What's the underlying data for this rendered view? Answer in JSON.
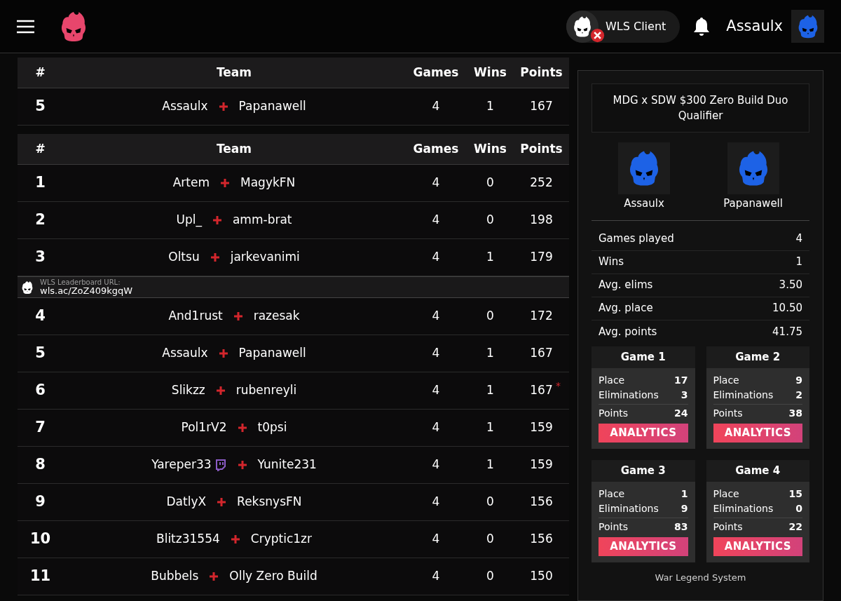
{
  "header": {
    "client": {
      "label": "WLS Client",
      "connected": false
    },
    "username": "Assaulx"
  },
  "my_team": {
    "columns": [
      "#",
      "Team",
      "Games",
      "Wins",
      "Points"
    ],
    "rows": [
      {
        "kind": "team",
        "rank": "5",
        "players": [
          {
            "name": "Assaulx",
            "streaming": false
          },
          {
            "name": "Papanawell",
            "streaming": false
          }
        ],
        "games": "4",
        "wins": "1",
        "points": "167"
      }
    ]
  },
  "leaderboard": {
    "columns": [
      "#",
      "Team",
      "Games",
      "Wins",
      "Points"
    ],
    "rows": [
      {
        "kind": "team",
        "rank": "1",
        "players": [
          {
            "name": "Artem",
            "streaming": false
          },
          {
            "name": "MagykFN",
            "streaming": false
          }
        ],
        "games": "4",
        "wins": "0",
        "points": "252"
      },
      {
        "kind": "team",
        "rank": "2",
        "players": [
          {
            "name": "Upl_",
            "streaming": false
          },
          {
            "name": "amm-brat",
            "streaming": false
          }
        ],
        "games": "4",
        "wins": "0",
        "points": "198"
      },
      {
        "kind": "team",
        "rank": "3",
        "players": [
          {
            "name": "Oltsu",
            "streaming": false
          },
          {
            "name": "jarkevanimi",
            "streaming": false
          }
        ],
        "games": "4",
        "wins": "1",
        "points": "179"
      },
      {
        "kind": "banner",
        "label": "WLS Leaderboard URL:",
        "url": "wls.ac/ZoZ409kgqW"
      },
      {
        "kind": "team",
        "rank": "4",
        "players": [
          {
            "name": "And1rust",
            "streaming": false
          },
          {
            "name": "razesak",
            "streaming": false
          }
        ],
        "games": "4",
        "wins": "0",
        "points": "172"
      },
      {
        "kind": "team",
        "rank": "5",
        "players": [
          {
            "name": "Assaulx",
            "streaming": false
          },
          {
            "name": "Papanawell",
            "streaming": false
          }
        ],
        "games": "4",
        "wins": "1",
        "points": "167"
      },
      {
        "kind": "team",
        "rank": "6",
        "players": [
          {
            "name": "Slikzz",
            "streaming": false
          },
          {
            "name": "rubenreyli",
            "streaming": false
          }
        ],
        "games": "4",
        "wins": "1",
        "points": "167",
        "points_note": "*"
      },
      {
        "kind": "team",
        "rank": "7",
        "players": [
          {
            "name": "Pol1rV2",
            "streaming": false
          },
          {
            "name": "t0psi",
            "streaming": false
          }
        ],
        "games": "4",
        "wins": "1",
        "points": "159"
      },
      {
        "kind": "team",
        "rank": "8",
        "players": [
          {
            "name": "Yareper33",
            "streaming": true
          },
          {
            "name": "Yunite231",
            "streaming": false
          }
        ],
        "games": "4",
        "wins": "1",
        "points": "159"
      },
      {
        "kind": "team",
        "rank": "9",
        "players": [
          {
            "name": "DatlyX",
            "streaming": false
          },
          {
            "name": "ReksnysFN",
            "streaming": false
          }
        ],
        "games": "4",
        "wins": "0",
        "points": "156"
      },
      {
        "kind": "team",
        "rank": "10",
        "players": [
          {
            "name": "Blitz31554",
            "streaming": false
          },
          {
            "name": "Cryptic1zr",
            "streaming": false
          }
        ],
        "games": "4",
        "wins": "0",
        "points": "156"
      },
      {
        "kind": "team",
        "rank": "11",
        "players": [
          {
            "name": "Bubbels",
            "streaming": false
          },
          {
            "name": "Olly Zero Build",
            "streaming": false
          }
        ],
        "games": "4",
        "wins": "0",
        "points": "150"
      }
    ]
  },
  "team_panel": {
    "event_title": "MDG x SDW $300 Zero Build Duo Qualifier",
    "players": [
      {
        "name": "Assaulx"
      },
      {
        "name": "Papanawell"
      }
    ],
    "stats": [
      {
        "label": "Games played",
        "value": "4"
      },
      {
        "label": "Wins",
        "value": "1"
      },
      {
        "label": "Avg. elims",
        "value": "3.50"
      },
      {
        "label": "Avg. place",
        "value": "10.50"
      },
      {
        "label": "Avg. points",
        "value": "41.75"
      }
    ],
    "games": [
      {
        "title": "Game 1",
        "rows": [
          {
            "label": "Place",
            "value": "17"
          },
          {
            "label": "Eliminations",
            "value": "3"
          }
        ],
        "total": {
          "label": "Points",
          "value": "24"
        },
        "button": "ANALYTICS"
      },
      {
        "title": "Game 2",
        "rows": [
          {
            "label": "Place",
            "value": "9"
          },
          {
            "label": "Eliminations",
            "value": "2"
          }
        ],
        "total": {
          "label": "Points",
          "value": "38"
        },
        "button": "ANALYTICS"
      },
      {
        "title": "Game 3",
        "rows": [
          {
            "label": "Place",
            "value": "1"
          },
          {
            "label": "Eliminations",
            "value": "9"
          }
        ],
        "total": {
          "label": "Points",
          "value": "83"
        },
        "button": "ANALYTICS"
      },
      {
        "title": "Game 4",
        "rows": [
          {
            "label": "Place",
            "value": "15"
          },
          {
            "label": "Eliminations",
            "value": "0"
          }
        ],
        "total": {
          "label": "Points",
          "value": "22"
        },
        "button": "ANALYTICS"
      }
    ],
    "footer": "War Legend System"
  }
}
